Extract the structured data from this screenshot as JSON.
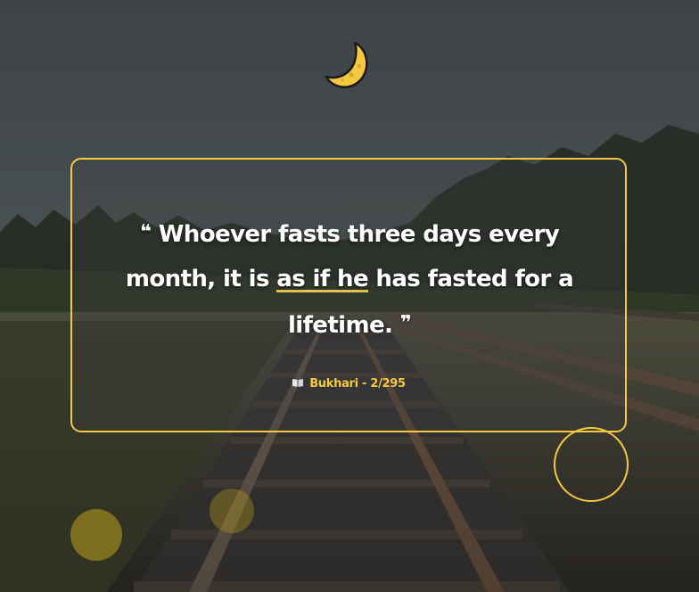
{
  "quote": {
    "open_mark": "❝",
    "before_highlight": "Whoever fasts three days every month, it is ",
    "highlight": "as if he",
    "after_highlight": " has fasted for a lifetime.",
    "close_mark": "❞"
  },
  "source": {
    "icon": "book-icon",
    "text": "Bukhari - 2/295"
  },
  "decor": {
    "icon": "crescent-moon-icon",
    "accent_color": "#f5c842"
  }
}
